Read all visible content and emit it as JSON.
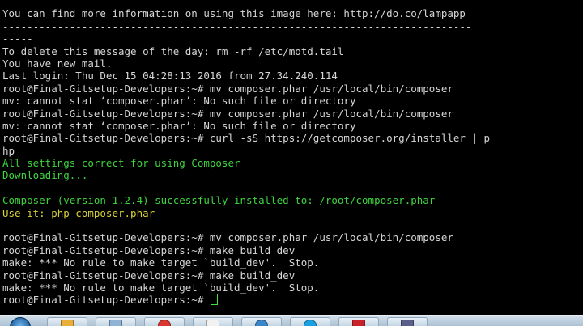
{
  "terminal": {
    "lines": [
      {
        "text": "-----",
        "color": "default"
      },
      {
        "text": "You can find more information on using this image here: http://do.co/lampapp",
        "color": "default"
      },
      {
        "text": "-----------------------------------------------------------------------------",
        "color": "default"
      },
      {
        "text": "-----",
        "color": "default"
      },
      {
        "text": "To delete this message of the day: rm -rf /etc/motd.tail",
        "color": "default"
      },
      {
        "text": "You have new mail.",
        "color": "default"
      },
      {
        "text": "Last login: Thu Dec 15 04:28:13 2016 from 27.34.240.114",
        "color": "default"
      },
      {
        "text": "root@Final-Gitsetup-Developers:~# mv composer.phar /usr/local/bin/composer",
        "color": "default"
      },
      {
        "text": "mv: cannot stat ‘composer.phar’: No such file or directory",
        "color": "default"
      },
      {
        "text": "root@Final-Gitsetup-Developers:~# mv composer.phar /usr/local/bin/composer",
        "color": "default"
      },
      {
        "text": "mv: cannot stat ‘composer.phar’: No such file or directory",
        "color": "default"
      },
      {
        "text": "root@Final-Gitsetup-Developers:~# curl -sS https://getcomposer.org/installer | p",
        "color": "default"
      },
      {
        "text": "hp",
        "color": "default"
      },
      {
        "text": "All settings correct for using Composer",
        "color": "green"
      },
      {
        "text": "Downloading...",
        "color": "green"
      },
      {
        "text": "",
        "color": "default"
      },
      {
        "text": "Composer (version 1.2.4) successfully installed to: /root/composer.phar",
        "color": "green"
      },
      {
        "text": "Use it: php composer.phar",
        "color": "yellow"
      },
      {
        "text": "",
        "color": "default"
      },
      {
        "text": "root@Final-Gitsetup-Developers:~# mv composer.phar /usr/local/bin/composer",
        "color": "default"
      },
      {
        "text": "root@Final-Gitsetup-Developers:~# make build_dev",
        "color": "default"
      },
      {
        "text": "make: *** No rule to make target `build_dev'.  Stop.",
        "color": "default"
      },
      {
        "text": "root@Final-Gitsetup-Developers:~# make build_dev",
        "color": "default"
      },
      {
        "text": "make: *** No rule to make target `build_dev'.  Stop.",
        "color": "default"
      },
      {
        "text": "root@Final-Gitsetup-Developers:~# ",
        "color": "default",
        "cursor": true
      }
    ]
  },
  "taskbar": {
    "items": [
      {
        "icon": "folder-icon",
        "color": "#e8b03a"
      },
      {
        "icon": "document-icon",
        "color": "#8fb4d6"
      },
      {
        "icon": "chrome-icon",
        "color": "#d9372f"
      },
      {
        "icon": "notepad-icon",
        "color": "#f2f2f2"
      },
      {
        "icon": "globe-icon",
        "color": "#3a86c8"
      },
      {
        "icon": "skype-icon",
        "color": "#1aa0e0"
      },
      {
        "icon": "filezilla-icon",
        "color": "#c8232a"
      },
      {
        "icon": "putty-icon",
        "color": "#5a5f8a"
      }
    ]
  }
}
